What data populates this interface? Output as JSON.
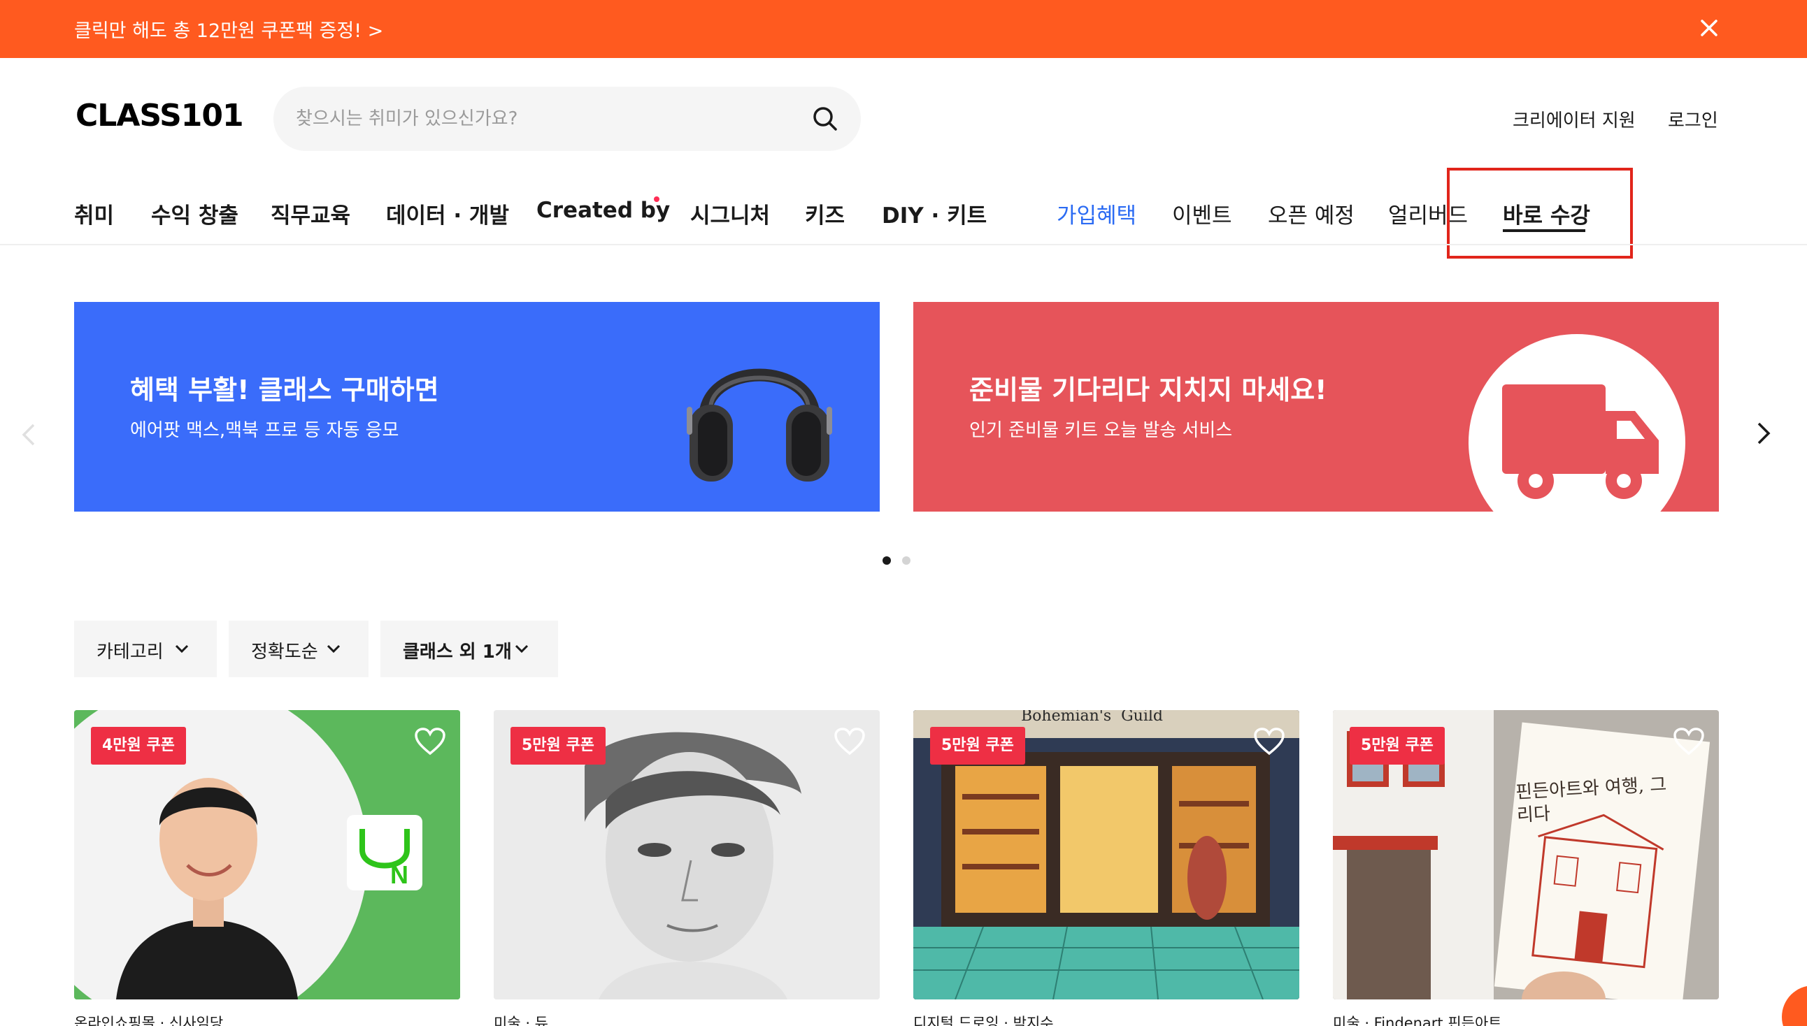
{
  "promo_bar": {
    "text": "클릭만 해도 총 12만원 쿠폰팩 증정! >",
    "close_icon": "close-icon",
    "background": "#ff5a1f"
  },
  "header": {
    "logo": "CLASS101",
    "search_placeholder": "찾으시는 취미가 있으신가요?",
    "search_icon": "search-icon",
    "links": [
      "크리에이터 지원",
      "로그인"
    ]
  },
  "nav": {
    "categories": [
      "취미",
      "수익 창출",
      "직무교육",
      "데이터 · 개발",
      "Created by",
      "시그니처",
      "키즈",
      "DIY · 키트"
    ],
    "specials": [
      "가입혜택",
      "이벤트",
      "오픈 예정",
      "얼리버드",
      "바로 수강"
    ],
    "active_item": "바로 수강",
    "accent_color": "#2b6bf3",
    "highlight_color": "#e1251b"
  },
  "banners": [
    {
      "title": "혜택 부활! 클래스 구매하면",
      "subtitle": "에어팟 맥스,맥북 프로 등 자동 응모",
      "color": "#3a6cfa",
      "icon": "headphones-icon"
    },
    {
      "title": "준비물 기다리다 지치지 마세요!",
      "subtitle": "인기 준비물 키트 오늘 발송 서비스",
      "color": "#e6545a",
      "icon": "truck-icon"
    }
  ],
  "carousel": {
    "total_pages": 2,
    "current_page": 1
  },
  "filters": [
    "카테고리",
    "정확도순",
    "클래스 외 1개"
  ],
  "cards": [
    {
      "coupon": "4만원 쿠폰",
      "meta": "온라인쇼핑몰 · 신사임당"
    },
    {
      "coupon": "5만원 쿠폰",
      "meta": "미술 · 듀"
    },
    {
      "coupon": "5만원 쿠폰",
      "meta": "디지털 드로잉 · 박지수",
      "image_text": "Bohemian's  Guild"
    },
    {
      "coupon": "5만원 쿠폰",
      "meta": "미술 · Findenart 핀든아트",
      "image_text": "핀든아트와 여행, 그리다"
    }
  ],
  "colors": {
    "coupon": "#ee2f44",
    "brand": "#ff5a1f"
  }
}
